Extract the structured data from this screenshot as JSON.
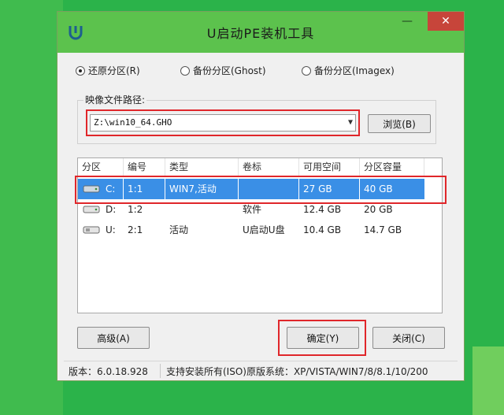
{
  "window": {
    "title": "U启动PE装机工具",
    "minimize_glyph": "—",
    "close_glyph": "✕"
  },
  "modes": [
    {
      "label": "还原分区(R)",
      "checked": true
    },
    {
      "label": "备份分区(Ghost)",
      "checked": false
    },
    {
      "label": "备份分区(Imagex)",
      "checked": false
    }
  ],
  "image": {
    "group_label": "映像文件路径:",
    "path_value": "Z:\\win10_64.GHO",
    "browse_label": "浏览(B)"
  },
  "table": {
    "headers": [
      "分区",
      "编号",
      "类型",
      "卷标",
      "可用空间",
      "分区容量"
    ],
    "rows": [
      {
        "part": "C:",
        "num": "1:1",
        "type": "WIN7,活动",
        "label": "",
        "free": "27 GB",
        "size": "40 GB",
        "selected": true
      },
      {
        "part": "D:",
        "num": "1:2",
        "type": "",
        "label": "软件",
        "free": "12.4 GB",
        "size": "20 GB",
        "selected": false
      },
      {
        "part": "U:",
        "num": "2:1",
        "type": "活动",
        "label": "U启动U盘",
        "free": "10.4 GB",
        "size": "14.7 GB",
        "selected": false
      }
    ]
  },
  "buttons": {
    "advanced": "高级(A)",
    "ok": "确定(Y)",
    "close": "关闭(C)"
  },
  "status": {
    "version": "版本：6.0.18.928",
    "support": "支持安装所有(ISO)原版系统：XP/VISTA/WIN7/8/8.1/10/200"
  },
  "colors": {
    "background": "#2bb34a",
    "titlebar": "#5cc24d",
    "selection": "#3a8fe6",
    "highlight": "#e0262a"
  }
}
